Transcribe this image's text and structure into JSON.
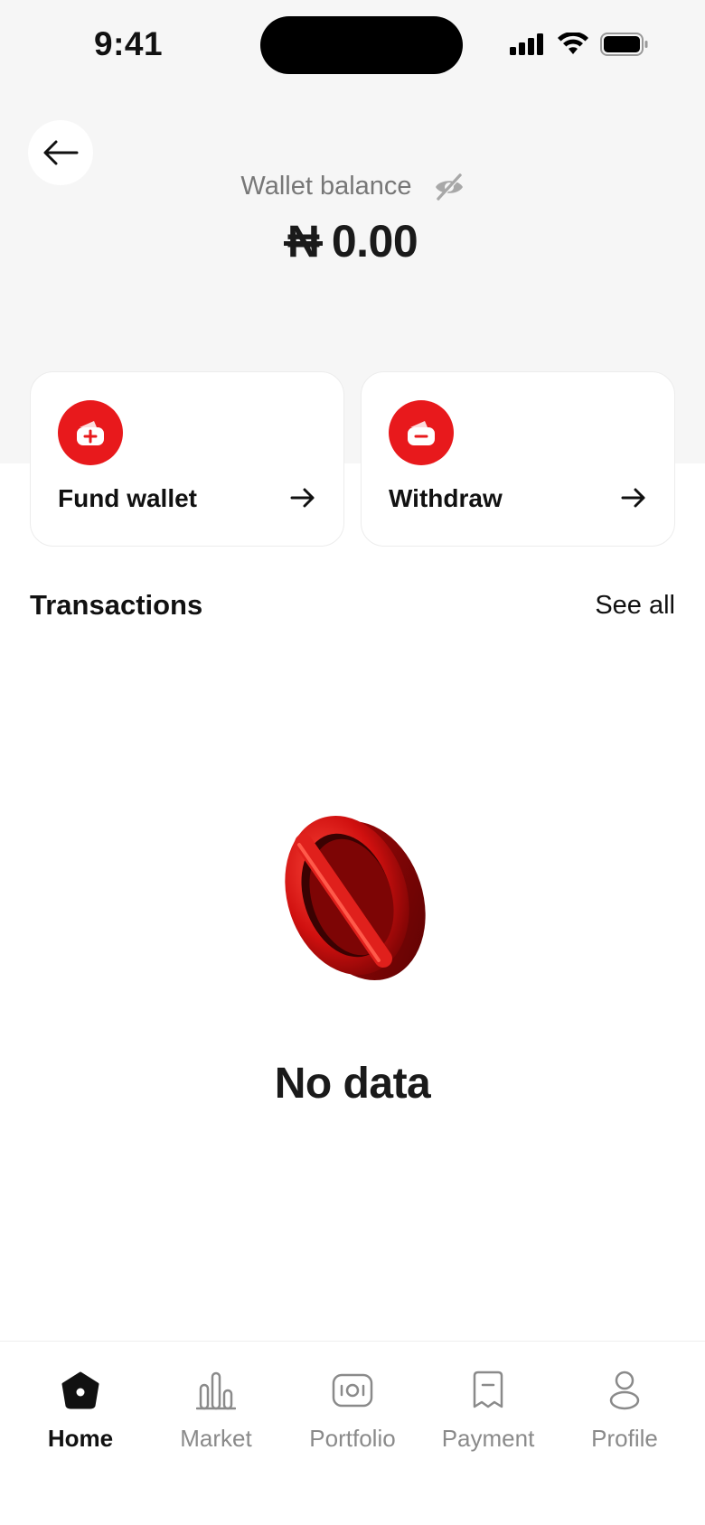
{
  "status_bar": {
    "time": "9:41"
  },
  "header": {
    "balance_label": "Wallet balance",
    "currency_symbol": "₦",
    "balance_amount": "0.00"
  },
  "actions": [
    {
      "label": "Fund wallet",
      "icon": "wallet-plus-icon"
    },
    {
      "label": "Withdraw",
      "icon": "wallet-minus-icon"
    }
  ],
  "transactions": {
    "title": "Transactions",
    "see_all_label": "See all",
    "empty_text": "No data"
  },
  "nav": [
    {
      "label": "Home",
      "icon": "home-icon",
      "active": true
    },
    {
      "label": "Market",
      "icon": "market-icon",
      "active": false
    },
    {
      "label": "Portfolio",
      "icon": "portfolio-icon",
      "active": false
    },
    {
      "label": "Payment",
      "icon": "payment-icon",
      "active": false
    },
    {
      "label": "Profile",
      "icon": "profile-icon",
      "active": false
    }
  ],
  "colors": {
    "accent": "#e8191c",
    "header_bg": "#f6f6f6",
    "text_primary": "#111111",
    "text_muted": "#777777"
  }
}
